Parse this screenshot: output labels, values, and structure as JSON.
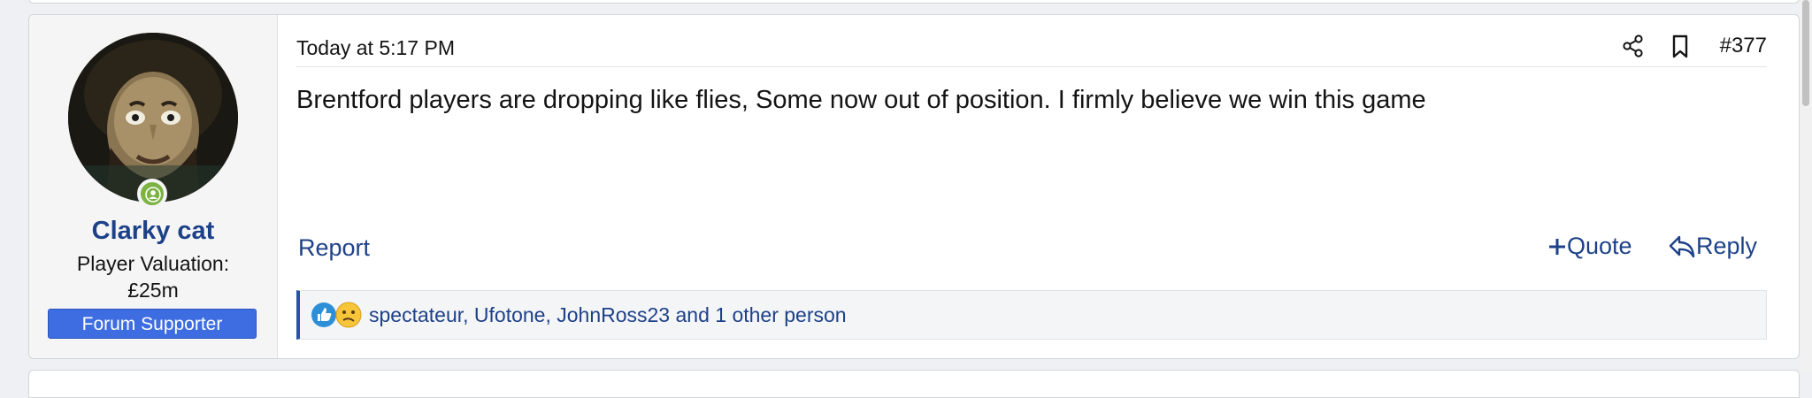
{
  "user": {
    "name": "Clarky cat",
    "valuation_label": "Player Valuation:",
    "valuation_value": "£25m",
    "badge": "Forum Supporter"
  },
  "post": {
    "time": "Today at 5:17 PM",
    "number": "#377",
    "body": "Brentford players are dropping like flies, Some now out of position. I firmly believe we win this game"
  },
  "actions": {
    "report": "Report",
    "quote": "Quote",
    "reply": "Reply"
  },
  "reactions": {
    "icons": [
      "like-icon",
      "confused-icon"
    ],
    "text": "spectateur, Ufotone, JohnRoss23 and 1 other person"
  },
  "colors": {
    "link": "#1d4189",
    "badge": "#3d6de0",
    "online": "#7cb342",
    "reaction_bar": "#2753a8"
  }
}
